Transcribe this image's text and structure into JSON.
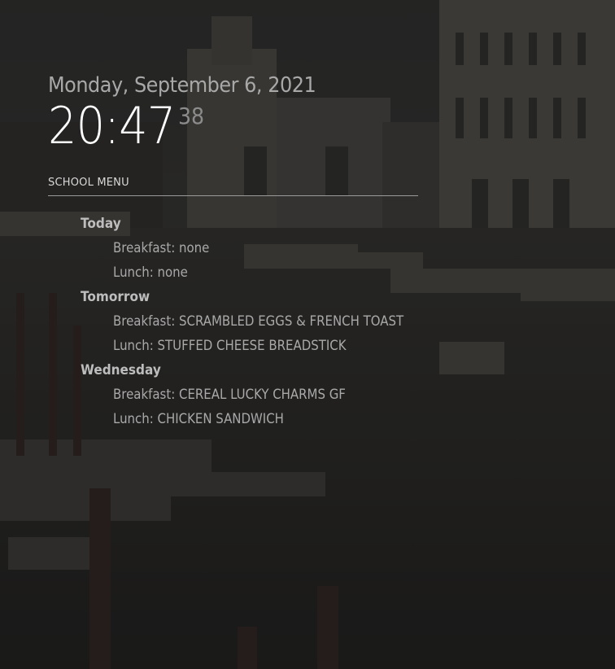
{
  "clock": {
    "date": "Monday, September 6, 2021",
    "time": "20:47",
    "seconds": "38"
  },
  "school_menu": {
    "header": "SCHOOL MENU",
    "days": [
      {
        "name": "Today",
        "breakfast": "Breakfast: none",
        "lunch": "Lunch: none"
      },
      {
        "name": "Tomorrow",
        "breakfast": "Breakfast: SCRAMBLED EGGS & FRENCH TOAST",
        "lunch": "Lunch: STUFFED CHEESE BREADSTICK"
      },
      {
        "name": "Wednesday",
        "breakfast": "Breakfast: CEREAL LUCKY CHARMS GF",
        "lunch": "Lunch: CHICKEN SANDWICH"
      }
    ]
  },
  "background": {
    "subject": "venice-grand-canal-photo",
    "tint": "#000000"
  }
}
